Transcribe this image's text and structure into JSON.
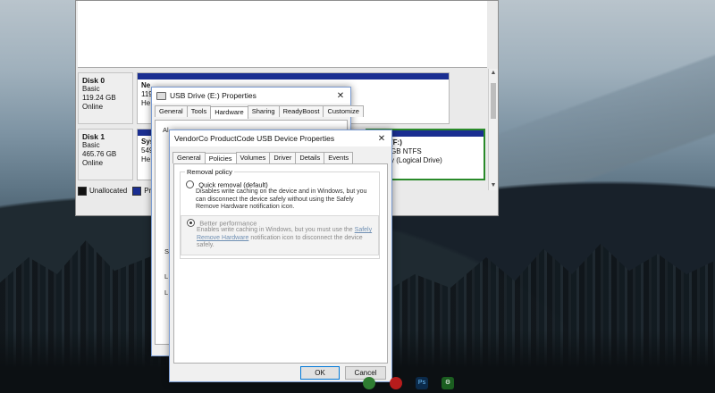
{
  "disk_management": {
    "disks": [
      {
        "name": "Disk 0",
        "type": "Basic",
        "size": "119.24 GB",
        "status": "Online",
        "partition": {
          "line1": "Ne",
          "line2": "119",
          "line3": "He"
        }
      },
      {
        "name": "Disk 1",
        "type": "Basic",
        "size": "465.76 GB",
        "status": "Online",
        "partition_left": {
          "line1": "Sys",
          "line2": "549",
          "line3": "He"
        },
        "partition_right": {
          "line1": "(F:)",
          "line2": "GB NTFS",
          "line3": "y (Logical Drive)"
        }
      }
    ],
    "legend": [
      {
        "label": "Unallocated",
        "color": "#111111"
      },
      {
        "label": "Prim",
        "color": "#1a2e91"
      }
    ],
    "scroll_up": "▲",
    "scroll_down": "▼"
  },
  "usb_dialog": {
    "title": "USB Drive (E:) Properties",
    "close": "✕",
    "tabs_row1": [
      "General",
      "Tools",
      "Hardware",
      "Sharing",
      "ReadyBoost",
      "Customize"
    ],
    "active_tab": "Hardware",
    "panel_text_top": "Al",
    "panel_side_letters": [
      "S",
      "L",
      "L"
    ]
  },
  "vendor_dialog": {
    "title": "VendorCo ProductCode USB Device Properties",
    "close": "✕",
    "tabs": [
      "General",
      "Policies",
      "Volumes",
      "Driver",
      "Details",
      "Events"
    ],
    "active_tab": "Policies",
    "group_title": "Removal policy",
    "option1": {
      "label": "Quick removal (default)",
      "desc": "Disables write caching on the device and in Windows, but you can disconnect the device safely without using the Safely Remove Hardware notification icon."
    },
    "option2": {
      "label": "Better performance",
      "desc_before": "Enables write caching in Windows, but you must use the",
      "desc_link": "Safely Remove Hardware",
      "desc_after": "notification icon to disconnect the device safely."
    },
    "ok_label": "OK",
    "cancel_label": "Cancel"
  },
  "taskbar": {
    "icons": [
      {
        "name": "chrome-icon",
        "text": "",
        "color": "#2f7d32"
      },
      {
        "name": "app-red-icon",
        "text": "",
        "color": "#b71c1c"
      },
      {
        "name": "photoshop-icon",
        "text": "Ps",
        "color": "#0b2a4a"
      },
      {
        "name": "app-gear-icon",
        "text": "⚙",
        "color": "#1b5e20"
      }
    ]
  }
}
